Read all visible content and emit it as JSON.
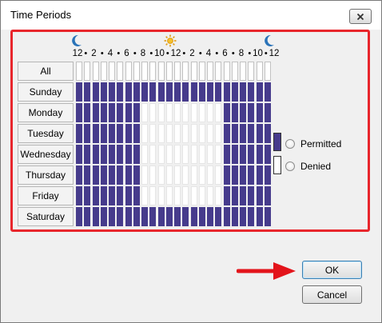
{
  "window": {
    "title": "Time Periods",
    "close_label": "✕"
  },
  "schedule": {
    "hour_labels": [
      "12",
      "2",
      "4",
      "6",
      "8",
      "10",
      "12",
      "2",
      "4",
      "6",
      "8",
      "10",
      "12"
    ],
    "icons": {
      "left": "moon-icon",
      "middle": "sun-icon",
      "right": "moon-icon"
    },
    "all_label": "All",
    "days": [
      "Sunday",
      "Monday",
      "Tuesday",
      "Wednesday",
      "Thursday",
      "Friday",
      "Saturday"
    ],
    "denied_start_hour": 8,
    "denied_end_hour": 18,
    "denied_days": [
      "Monday",
      "Tuesday",
      "Wednesday",
      "Thursday",
      "Friday"
    ]
  },
  "legend": {
    "permitted_label": "Permitted",
    "denied_label": "Denied"
  },
  "colors": {
    "permitted": "#463b8c",
    "denied": "#ffffff",
    "highlight": "#e8262c",
    "arrow": "#e3141b"
  },
  "buttons": {
    "ok_label": "OK",
    "cancel_label": "Cancel"
  }
}
